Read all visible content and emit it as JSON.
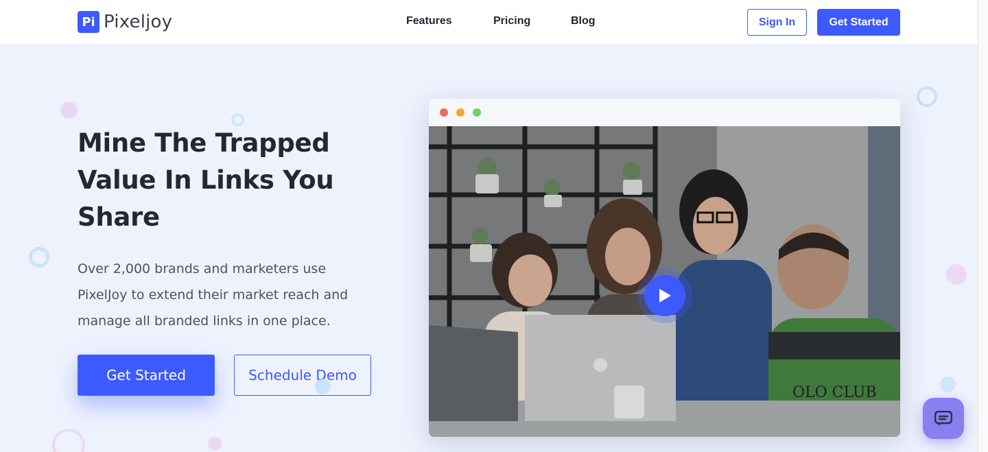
{
  "brand": {
    "logo_mark": "Pi",
    "name": "Pixeljoy"
  },
  "nav": {
    "items": [
      {
        "label": "Features"
      },
      {
        "label": "Pricing"
      },
      {
        "label": "Blog"
      }
    ]
  },
  "header_actions": {
    "sign_in": "Sign In",
    "get_started": "Get Started"
  },
  "hero": {
    "title": "Mine The Trapped Value In Links You Share",
    "description": "Over 2,000 brands and marketers use PixelJoy to extend their market reach and manage all branded links in one place.",
    "primary_cta": "Get Started",
    "secondary_cta": "Schedule Demo"
  },
  "video": {
    "play_icon": "play-icon"
  },
  "chat": {
    "icon": "chat-icon"
  },
  "colors": {
    "accent": "#3d5afe",
    "background": "#eef2fd",
    "chat": "#8a7ff0"
  }
}
